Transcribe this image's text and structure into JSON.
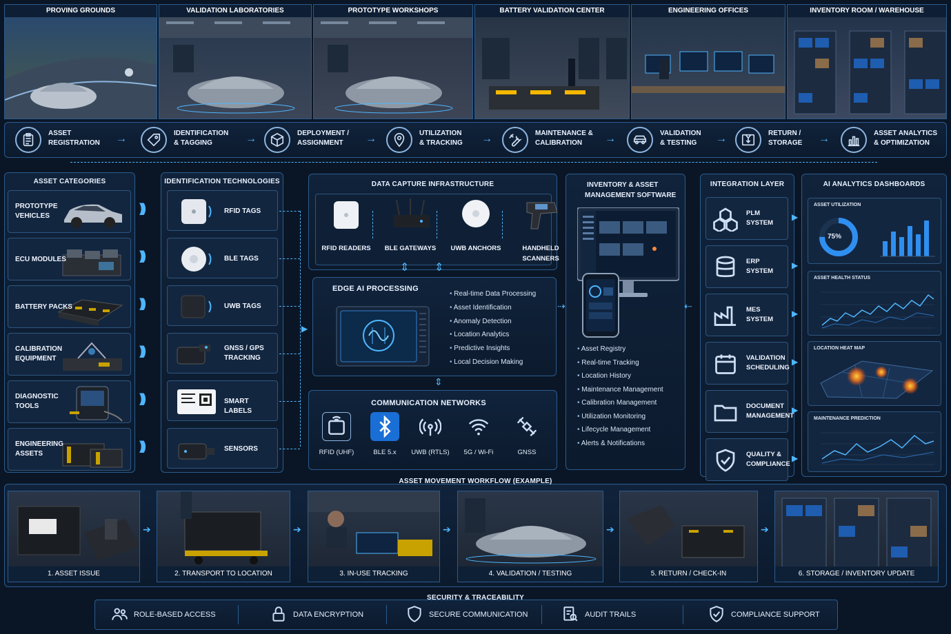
{
  "locations": [
    "PROVING GROUNDS",
    "VALIDATION LABORATORIES",
    "PROTOTYPE WORKSHOPS",
    "BATTERY VALIDATION CENTER",
    "ENGINEERING OFFICES",
    "INVENTORY ROOM / WAREHOUSE"
  ],
  "lifecycle": [
    {
      "l1": "ASSET",
      "l2": "REGISTRATION",
      "icon": "clipboard-icon"
    },
    {
      "l1": "IDENTIFICATION",
      "l2": "& TAGGING",
      "icon": "tag-icon"
    },
    {
      "l1": "DEPLOYMENT /",
      "l2": "ASSIGNMENT",
      "icon": "box-icon"
    },
    {
      "l1": "UTILIZATION",
      "l2": "& TRACKING",
      "icon": "location-pin-icon"
    },
    {
      "l1": "MAINTENANCE &",
      "l2": "CALIBRATION",
      "icon": "wrench-icon"
    },
    {
      "l1": "VALIDATION",
      "l2": "& TESTING",
      "icon": "car-icon"
    },
    {
      "l1": "RETURN /",
      "l2": "STORAGE",
      "icon": "return-box-icon"
    },
    {
      "l1": "ASSET ANALYTICS",
      "l2": "& OPTIMIZATION",
      "icon": "bar-chart-icon"
    }
  ],
  "asset_categories": {
    "title": "ASSET CATEGORIES",
    "items": [
      {
        "l1": "PROTOTYPE",
        "l2": "VEHICLES"
      },
      {
        "l1": "ECU MODULES",
        "l2": ""
      },
      {
        "l1": "BATTERY PACKS",
        "l2": ""
      },
      {
        "l1": "CALIBRATION",
        "l2": "EQUIPMENT"
      },
      {
        "l1": "DIAGNOSTIC",
        "l2": "TOOLS"
      },
      {
        "l1": "ENGINEERING",
        "l2": "ASSETS"
      }
    ]
  },
  "id_tech": {
    "title": "IDENTIFICATION TECHNOLOGIES",
    "items": [
      {
        "l1": "RFID TAGS",
        "l2": ""
      },
      {
        "l1": "BLE TAGS",
        "l2": ""
      },
      {
        "l1": "UWB TAGS",
        "l2": ""
      },
      {
        "l1": "GNSS / GPS",
        "l2": "TRACKING"
      },
      {
        "l1": "SMART LABELS",
        "l2": ""
      },
      {
        "l1": "SENSORS",
        "l2": ""
      }
    ]
  },
  "data_capture": {
    "title": "DATA CAPTURE INFRASTRUCTURE",
    "items": [
      {
        "l1": "RFID READERS",
        "l2": ""
      },
      {
        "l1": "BLE GATEWAYS",
        "l2": ""
      },
      {
        "l1": "UWB ANCHORS",
        "l2": ""
      },
      {
        "l1": "HANDHELD",
        "l2": "SCANNERS"
      }
    ]
  },
  "edge_ai": {
    "title": "EDGE AI PROCESSING",
    "bullets": [
      "Real-time Data Processing",
      "Asset Identification",
      "Anomaly Detection",
      "Location Analytics",
      "Predictive Insights",
      "Local Decision Making"
    ]
  },
  "comms": {
    "title": "COMMUNICATION NETWORKS",
    "items": [
      "RFID (UHF)",
      "BLE 5.x",
      "UWB (RTLS)",
      "5G / Wi-Fi",
      "GNSS"
    ]
  },
  "inventory": {
    "title1": "INVENTORY & ASSET",
    "title2": "MANAGEMENT SOFTWARE",
    "bullets": [
      "Asset Registry",
      "Real-time Tracking",
      "Location History",
      "Maintenance Management",
      "Calibration Management",
      "Utilization Monitoring",
      "Lifecycle Management",
      "Alerts & Notifications"
    ]
  },
  "integration": {
    "title": "INTEGRATION LAYER",
    "items": [
      {
        "l1": "PLM",
        "l2": "SYSTEM"
      },
      {
        "l1": "ERP",
        "l2": "SYSTEM"
      },
      {
        "l1": "MES",
        "l2": "SYSTEM"
      },
      {
        "l1": "VALIDATION",
        "l2": "SCHEDULING"
      },
      {
        "l1": "DOCUMENT",
        "l2": "MANAGEMENT"
      },
      {
        "l1": "QUALITY &",
        "l2": "COMPLIANCE"
      }
    ]
  },
  "dashboards": {
    "title": "AI ANALYTICS DASHBOARDS",
    "utilization_title": "ASSET UTILIZATION",
    "utilization_value": "75%",
    "utilization_fraction": 0.75,
    "health_title": "ASSET HEALTH STATUS",
    "heatmap_title": "LOCATION HEAT MAP",
    "prediction_title": "MAINTENANCE PREDICTION"
  },
  "workflow": {
    "title": "ASSET MOVEMENT WORKFLOW (EXAMPLE)",
    "steps": [
      "1. ASSET ISSUE",
      "2. TRANSPORT TO LOCATION",
      "3. IN-USE TRACKING",
      "4. VALIDATION / TESTING",
      "5. RETURN / CHECK-IN",
      "6. STORAGE / INVENTORY UPDATE"
    ]
  },
  "security": {
    "title": "SECURITY & TRACEABILITY",
    "items": [
      "ROLE-BASED ACCESS",
      "DATA ENCRYPTION",
      "SECURE COMMUNICATION",
      "AUDIT TRAILS",
      "COMPLIANCE SUPPORT"
    ]
  },
  "colors": {
    "accent": "#4fb6ff",
    "panel_border": "#2b5c8f",
    "background": "#0a1626"
  }
}
